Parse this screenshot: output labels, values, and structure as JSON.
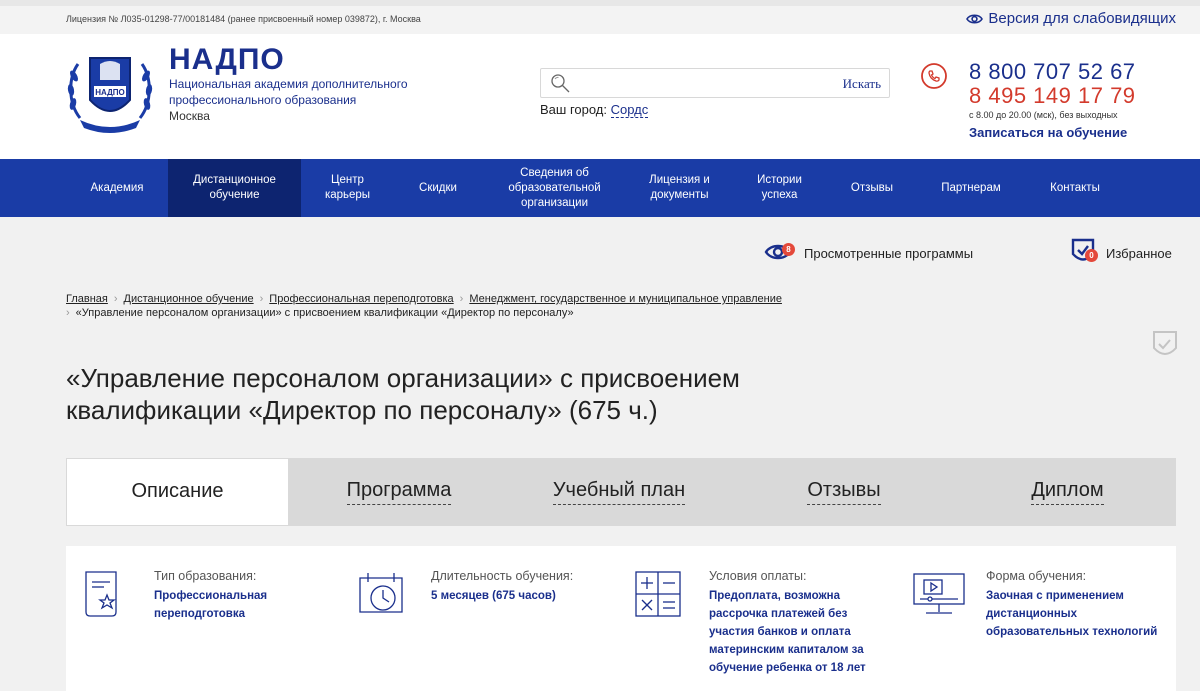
{
  "topbar": {
    "license": "Лицензия № Л035-01298-77/00181484 (ранее присвоенный номер 039872), г. Москва",
    "vision_label": "Версия для слабовидящих"
  },
  "brand": {
    "title": "НАДПО",
    "subtitle": "Национальная академия дополнительного профессионального образования",
    "city": "Москва",
    "logo_text": "НАДПО"
  },
  "search": {
    "placeholder": "",
    "button_label": "Искать",
    "city_prefix": "Ваш город:",
    "city_name": "Сордс"
  },
  "contacts": {
    "phone1": "8 800 707 52 67",
    "phone2": "8 495 149 17 79",
    "hours": "с 8.00 до 20.00 (мск), без выходных",
    "enroll_label": "Записаться на обучение"
  },
  "nav": {
    "items": [
      {
        "label": "Академия"
      },
      {
        "label": "Дистанционное обучение"
      },
      {
        "label": "Центр карьеры"
      },
      {
        "label": "Скидки"
      },
      {
        "label": "Сведения об образовательной организации"
      },
      {
        "label": "Лицензия и документы"
      },
      {
        "label": "Истории успеха"
      },
      {
        "label": "Отзывы"
      },
      {
        "label": "Партнерам"
      },
      {
        "label": "Контакты"
      }
    ],
    "active_index": 1
  },
  "user_tools": {
    "viewed_label": "Просмотренные программы",
    "viewed_count": "8",
    "favorites_label": "Избранное",
    "favorites_count": "0"
  },
  "breadcrumbs": {
    "items": [
      "Главная",
      "Дистанционное обучение",
      "Профессиональная переподготовка",
      "Менеджмент, государственное и муниципальное управление"
    ],
    "current": "«Управление персоналом организации» с присвоением квалификации «Директор по персоналу»"
  },
  "page_title": "«Управление персоналом организации» с присвоением квалификации «Директор по персоналу» (675 ч.)",
  "tabs": {
    "items": [
      {
        "label": "Описание"
      },
      {
        "label": "Программа"
      },
      {
        "label": "Учебный план"
      },
      {
        "label": "Отзывы"
      },
      {
        "label": "Диплом"
      }
    ],
    "active_index": 0
  },
  "info": [
    {
      "label": "Тип образования:",
      "value": "Профессиональная переподготовка",
      "icon": "certificate-icon"
    },
    {
      "label": "Длительность обучения:",
      "value": "5 месяцев (675 часов)",
      "icon": "calendar-clock-icon"
    },
    {
      "label": "Условия оплаты:",
      "value": "Предоплата, возможна рассрочка платежей без участия банков и оплата материнским капиталом за обучение ребенка от 18 лет",
      "icon": "calculator-icon"
    },
    {
      "label": "Форма обучения:",
      "value": "Заочная с применением дистанционных образовательных технологий",
      "icon": "video-screen-icon"
    }
  ],
  "colors": {
    "brand_blue": "#1a2f8c",
    "nav_blue": "#1a3ca6",
    "nav_active": "#0d2470",
    "accent_red": "#d33a2c",
    "background_grey": "#f1f1f1"
  }
}
